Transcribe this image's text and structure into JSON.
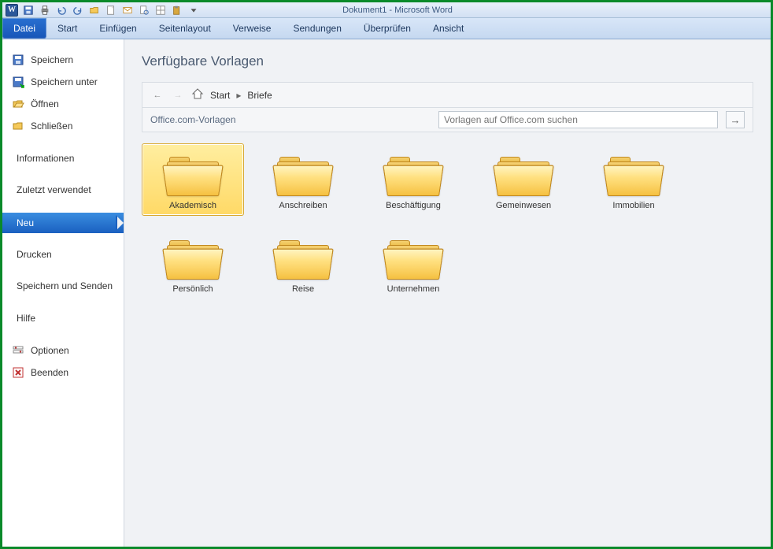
{
  "window": {
    "title": "Dokument1  -  Microsoft Word"
  },
  "qat": {
    "icons": [
      "save",
      "quickprint",
      "undo",
      "redo",
      "open",
      "new",
      "mail",
      "preview",
      "more",
      "options"
    ]
  },
  "ribbon": {
    "tabs": [
      "Datei",
      "Start",
      "Einfügen",
      "Seitenlayout",
      "Verweise",
      "Sendungen",
      "Überprüfen",
      "Ansicht"
    ],
    "active": 0
  },
  "sidebar": {
    "items": [
      {
        "label": "Speichern",
        "icon": "save"
      },
      {
        "label": "Speichern unter",
        "icon": "saveas"
      },
      {
        "label": "Öffnen",
        "icon": "open"
      },
      {
        "label": "Schließen",
        "icon": "close"
      },
      {
        "label": "Informationen",
        "icon": null
      },
      {
        "label": "Zuletzt verwendet",
        "icon": null
      },
      {
        "label": "Neu",
        "icon": null,
        "selected": true
      },
      {
        "label": "Drucken",
        "icon": null
      },
      {
        "label": "Speichern und Senden",
        "icon": null
      },
      {
        "label": "Hilfe",
        "icon": null
      },
      {
        "label": "Optionen",
        "icon": "options"
      },
      {
        "label": "Beenden",
        "icon": "exit"
      }
    ]
  },
  "content": {
    "heading": "Verfügbare Vorlagen",
    "breadcrumb": {
      "home": "Start",
      "current": "Briefe"
    },
    "search_label": "Office.com-Vorlagen",
    "search_placeholder": "Vorlagen auf Office.com suchen",
    "templates": [
      {
        "label": "Akademisch",
        "selected": true
      },
      {
        "label": "Anschreiben"
      },
      {
        "label": "Beschäftigung"
      },
      {
        "label": "Gemeinwesen"
      },
      {
        "label": "Immobilien"
      },
      {
        "label": "Persönlich"
      },
      {
        "label": "Reise"
      },
      {
        "label": "Unternehmen"
      }
    ]
  }
}
